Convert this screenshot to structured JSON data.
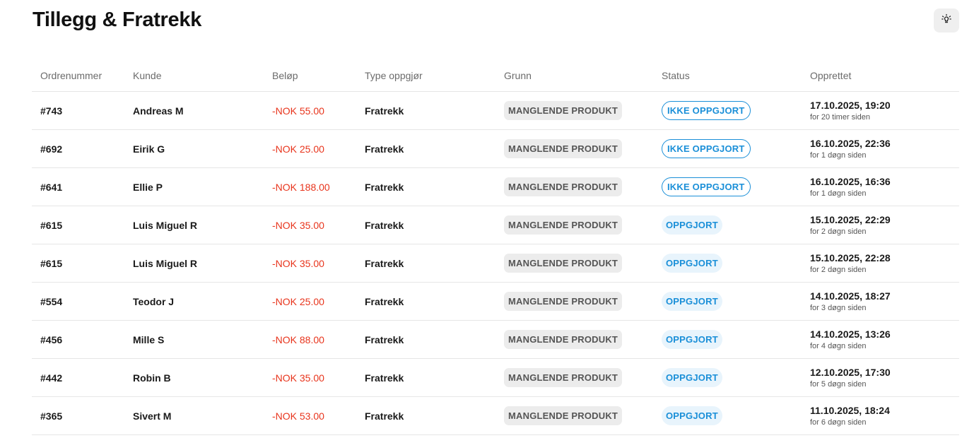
{
  "page": {
    "title": "Tillegg & Fratrekk",
    "hint_icon": "lightbulb-icon"
  },
  "table": {
    "columns": {
      "order": "Ordrenummer",
      "customer": "Kunde",
      "amount": "Beløp",
      "type": "Type oppgjør",
      "reason": "Grunn",
      "status": "Status",
      "created": "Opprettet"
    },
    "rows": [
      {
        "order": "#743",
        "customer": "Andreas M",
        "amount": "-NOK 55.00",
        "type": "Fratrekk",
        "reason": "MANGLENDE PRODUKT",
        "status": "IKKE OPPGJORT",
        "status_kind": "open",
        "date": "17.10.2025, 19:20",
        "ago": "for 20 timer siden"
      },
      {
        "order": "#692",
        "customer": "Eirik G",
        "amount": "-NOK 25.00",
        "type": "Fratrekk",
        "reason": "MANGLENDE PRODUKT",
        "status": "IKKE OPPGJORT",
        "status_kind": "open",
        "date": "16.10.2025, 22:36",
        "ago": "for 1 døgn siden"
      },
      {
        "order": "#641",
        "customer": "Ellie P",
        "amount": "-NOK 188.00",
        "type": "Fratrekk",
        "reason": "MANGLENDE PRODUKT",
        "status": "IKKE OPPGJORT",
        "status_kind": "open",
        "date": "16.10.2025, 16:36",
        "ago": "for 1 døgn siden"
      },
      {
        "order": "#615",
        "customer": "Luis Miguel R",
        "amount": "-NOK 35.00",
        "type": "Fratrekk",
        "reason": "MANGLENDE PRODUKT",
        "status": "OPPGJORT",
        "status_kind": "done",
        "date": "15.10.2025, 22:29",
        "ago": "for 2 døgn siden"
      },
      {
        "order": "#615",
        "customer": "Luis Miguel R",
        "amount": "-NOK 35.00",
        "type": "Fratrekk",
        "reason": "MANGLENDE PRODUKT",
        "status": "OPPGJORT",
        "status_kind": "done",
        "date": "15.10.2025, 22:28",
        "ago": "for 2 døgn siden"
      },
      {
        "order": "#554",
        "customer": "Teodor J",
        "amount": "-NOK 25.00",
        "type": "Fratrekk",
        "reason": "MANGLENDE PRODUKT",
        "status": "OPPGJORT",
        "status_kind": "done",
        "date": "14.10.2025, 18:27",
        "ago": "for 3 døgn siden"
      },
      {
        "order": "#456",
        "customer": "Mille S",
        "amount": "-NOK 88.00",
        "type": "Fratrekk",
        "reason": "MANGLENDE PRODUKT",
        "status": "OPPGJORT",
        "status_kind": "done",
        "date": "14.10.2025, 13:26",
        "ago": "for 4 døgn siden"
      },
      {
        "order": "#442",
        "customer": "Robin B",
        "amount": "-NOK 35.00",
        "type": "Fratrekk",
        "reason": "MANGLENDE PRODUKT",
        "status": "OPPGJORT",
        "status_kind": "done",
        "date": "12.10.2025, 17:30",
        "ago": "for 5 døgn siden"
      },
      {
        "order": "#365",
        "customer": "Sivert M",
        "amount": "-NOK 53.00",
        "type": "Fratrekk",
        "reason": "MANGLENDE PRODUKT",
        "status": "OPPGJORT",
        "status_kind": "done",
        "date": "11.10.2025, 18:24",
        "ago": "for 6 døgn siden"
      }
    ]
  },
  "colors": {
    "amount_negative": "#e8341c",
    "status_accent": "#1a8fd8",
    "status_done_bg": "#e8f4fc",
    "reason_pill_bg": "#ececec"
  }
}
